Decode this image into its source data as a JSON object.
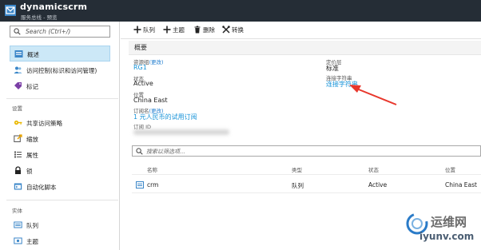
{
  "titlebar": {
    "title": "dynamicscrm",
    "subtitle": "服务总线 - 预览"
  },
  "sidebar": {
    "search_placeholder": "Search (Ctrl+/)",
    "items_top": [
      {
        "label": "概述",
        "icon": "overview-icon",
        "active": true
      },
      {
        "label": "访问控制(标识和访问管理)",
        "icon": "people-icon"
      },
      {
        "label": "标记",
        "icon": "tag-icon"
      }
    ],
    "section_settings": "设置",
    "items_settings": [
      {
        "label": "共享访问策略",
        "icon": "key-icon"
      },
      {
        "label": "缩放",
        "icon": "scale-icon"
      },
      {
        "label": "属性",
        "icon": "properties-icon"
      },
      {
        "label": "锁",
        "icon": "lock-icon"
      },
      {
        "label": "自动化脚本",
        "icon": "script-icon"
      }
    ],
    "section_entities": "实体",
    "items_entities": [
      {
        "label": "队列",
        "icon": "queue-icon"
      },
      {
        "label": "主题",
        "icon": "topic-icon"
      }
    ]
  },
  "toolbar": {
    "queue_label": "队列",
    "topic_label": "主题",
    "delete_label": "删除",
    "convert_label": "转换"
  },
  "essentials": {
    "title": "概要",
    "resource_group_label": "资源组",
    "change_label": "(更改)",
    "resource_group_value": "RG1",
    "status_label": "状态",
    "status_value": "Active",
    "location_label": "位置",
    "location_value": "China East",
    "subscription_name_label": "订阅名",
    "subscription_name_value": "1 元人民币的试用订阅",
    "subscription_id_label": "订阅 ID",
    "pricing_tier_label": "定价层",
    "pricing_tier_value": "标准",
    "connection_string_label": "连接字符串",
    "connection_string_value": "连接字符串"
  },
  "table": {
    "filter_placeholder": "搜索以筛选项...",
    "headers": [
      "名称",
      "类型",
      "状态",
      "位置"
    ],
    "rows": [
      {
        "name": "crm",
        "type": "队列",
        "status": "Active",
        "location": "China East"
      }
    ]
  },
  "watermark": {
    "line1": "运维网",
    "line2": "iyunv.com"
  },
  "colors": {
    "accent": "#1592d8",
    "titlebar": "#252d36",
    "active_nav": "#cce8f7",
    "arrow": "#e8372c"
  }
}
